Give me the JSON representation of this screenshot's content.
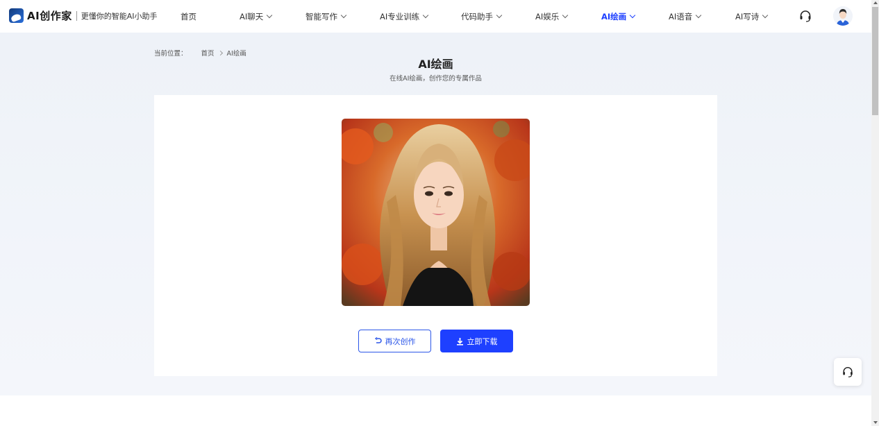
{
  "brand": {
    "name": "AI创作家",
    "slogan": "更懂你的智能AI小助手",
    "accent_color": "#1e40ff"
  },
  "nav": {
    "items": [
      {
        "label": "首页",
        "has_dropdown": false,
        "active": false
      },
      {
        "label": "AI聊天",
        "has_dropdown": true,
        "active": false
      },
      {
        "label": "智能写作",
        "has_dropdown": true,
        "active": false
      },
      {
        "label": "AI专业训练",
        "has_dropdown": true,
        "active": false
      },
      {
        "label": "代码助手",
        "has_dropdown": true,
        "active": false
      },
      {
        "label": "AI娱乐",
        "has_dropdown": true,
        "active": false
      },
      {
        "label": "AI绘画",
        "has_dropdown": true,
        "active": true
      },
      {
        "label": "AI语音",
        "has_dropdown": true,
        "active": false
      },
      {
        "label": "AI写诗",
        "has_dropdown": true,
        "active": false
      }
    ],
    "support_icon": "headset-icon",
    "avatar_icon": "user-avatar"
  },
  "breadcrumb": {
    "label": "当前位置：",
    "home": "首页",
    "current": "AI绘画"
  },
  "page": {
    "title": "AI绘画",
    "subtitle": "在线AI绘画，创作您的专属作品"
  },
  "result": {
    "image_icon": "generated-portrait-image"
  },
  "actions": {
    "recreate_label": "再次创作",
    "download_label": "立即下载"
  },
  "floating": {
    "support_icon": "headset-icon"
  }
}
